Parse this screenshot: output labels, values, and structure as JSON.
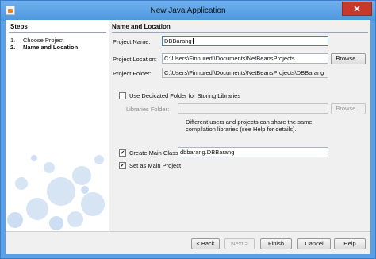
{
  "window": {
    "title": "New Java Application",
    "close_glyph": "✕"
  },
  "steps": {
    "header": "Steps",
    "items": [
      {
        "number": "1.",
        "label": "Choose Project"
      },
      {
        "number": "2.",
        "label": "Name and Location"
      }
    ]
  },
  "section": {
    "title": "Name and Location"
  },
  "form": {
    "project_name": {
      "label": "Project Name:",
      "value": "DBBarang"
    },
    "project_location": {
      "label": "Project Location:",
      "value": "C:\\Users\\Finnuredi\\Documents\\NetBeansProjects",
      "browse_label": "Browse..."
    },
    "project_folder": {
      "label": "Project Folder:",
      "value": "C:\\Users\\Finnuredi\\Documents\\NetBeansProjects\\DBBarang"
    },
    "dedicated_folder": {
      "label": "Use Dedicated Folder for Storing Libraries",
      "checked": false
    },
    "libraries_folder": {
      "label": "Libraries Folder:",
      "value": "",
      "browse_label": "Browse..."
    },
    "libraries_help": "Different users and projects can share the same compilation libraries (see Help for details).",
    "create_main_class": {
      "label": "Create Main Class",
      "checked": true,
      "value": "dbbarang.DBBarang"
    },
    "set_main_project": {
      "label": "Set as Main Project",
      "checked": true
    }
  },
  "buttons": {
    "back": "< Back",
    "next": "Next >",
    "finish": "Finish",
    "cancel": "Cancel",
    "help": "Help"
  },
  "icons": {
    "app": "netbeans-app-icon",
    "close": "close-icon",
    "checkbox_checked": "checkmark-icon"
  }
}
